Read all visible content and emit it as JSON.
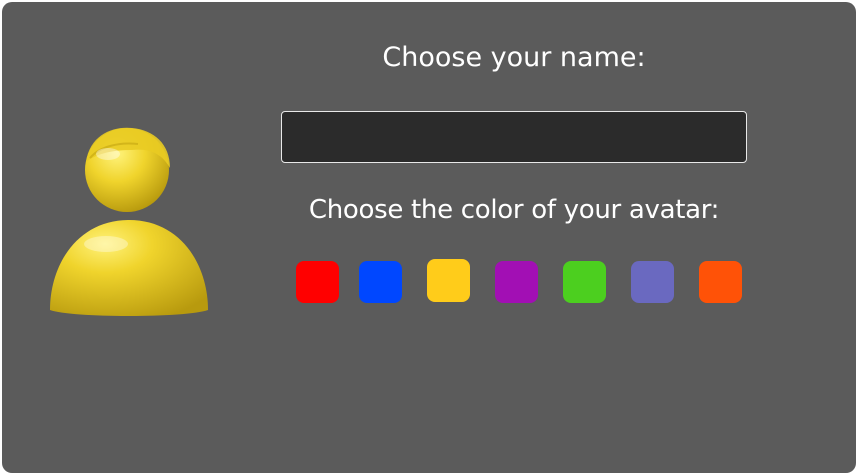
{
  "form": {
    "name_label": "Choose your name:",
    "name_value": "",
    "color_label": "Choose the color of your avatar:"
  },
  "avatar": {
    "icon": "person-icon",
    "color": "#f0d42c"
  },
  "colors": [
    {
      "name": "red",
      "hex": "#ff0000"
    },
    {
      "name": "blue",
      "hex": "#0047ff"
    },
    {
      "name": "yellow",
      "hex": "#ffcc1a"
    },
    {
      "name": "purple",
      "hex": "#a20fb4"
    },
    {
      "name": "green",
      "hex": "#4ccf1f"
    },
    {
      "name": "slate-blue",
      "hex": "#6a69c0"
    },
    {
      "name": "orange",
      "hex": "#ff5207"
    }
  ],
  "theme": {
    "panel_bg": "#5b5b5b",
    "input_bg": "#2b2b2b",
    "text": "#ffffff"
  }
}
